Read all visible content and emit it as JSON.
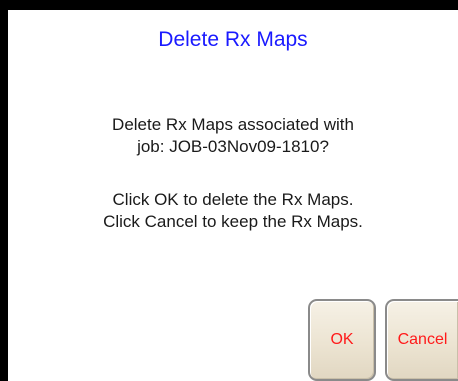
{
  "dialog": {
    "title": "Delete Rx Maps",
    "message_lines": [
      "Delete Rx Maps associated with",
      "job: JOB-03Nov09-1810?",
      "Click OK to delete the Rx Maps.",
      "Click Cancel to keep the Rx Maps."
    ],
    "ok_label": "OK",
    "cancel_label": "Cancel"
  },
  "colors": {
    "title": "#1a1aff",
    "button_text": "#ff1a1a",
    "background": "#ffffff",
    "frame": "#000000"
  }
}
